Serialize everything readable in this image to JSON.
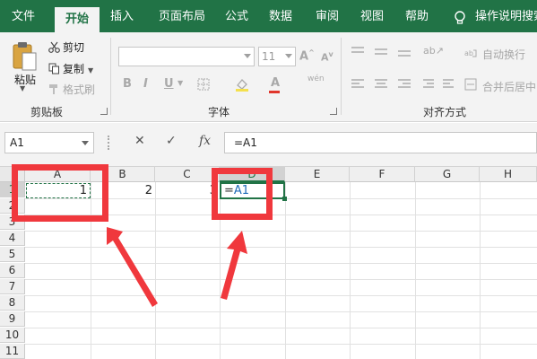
{
  "ribbon_tabs": [
    {
      "label": "文件"
    },
    {
      "label": "开始"
    },
    {
      "label": "插入"
    },
    {
      "label": "页面布局"
    },
    {
      "label": "公式"
    },
    {
      "label": "数据"
    },
    {
      "label": "审阅"
    },
    {
      "label": "视图"
    },
    {
      "label": "帮助"
    },
    {
      "label": "操作说明搜索"
    }
  ],
  "clipboard": {
    "paste_label": "粘贴",
    "cut_label": "剪切",
    "copy_label": "复制",
    "format_painter_label": "格式刷",
    "group_label": "剪贴板"
  },
  "font": {
    "size_value": "11",
    "group_label": "字体",
    "bold": "B",
    "italic": "I",
    "underline": "U",
    "grow": "A",
    "shrink": "A",
    "color": "A",
    "phonetic": "wén"
  },
  "alignment": {
    "wrap_text_label": "自动换行",
    "merge_center_label": "合并后居中",
    "group_label": "对齐方式"
  },
  "formula_bar": {
    "name_box": "A1",
    "formula": "=A1"
  },
  "sheet": {
    "columns": [
      "A",
      "B",
      "C",
      "D",
      "E",
      "F",
      "G",
      "H"
    ],
    "rows": [
      "1",
      "2",
      "3",
      "4",
      "5",
      "6",
      "7",
      "8",
      "9",
      "10",
      "11"
    ],
    "cells": {
      "A1": "1",
      "B1": "2",
      "C1": "3"
    },
    "editing_cell_formula_prefix": "=",
    "editing_cell_formula_ref": "A1"
  },
  "colors": {
    "ribbon_green": "#217346",
    "annotation_red": "#f0383d",
    "reference_blue": "#1f6bb8"
  }
}
